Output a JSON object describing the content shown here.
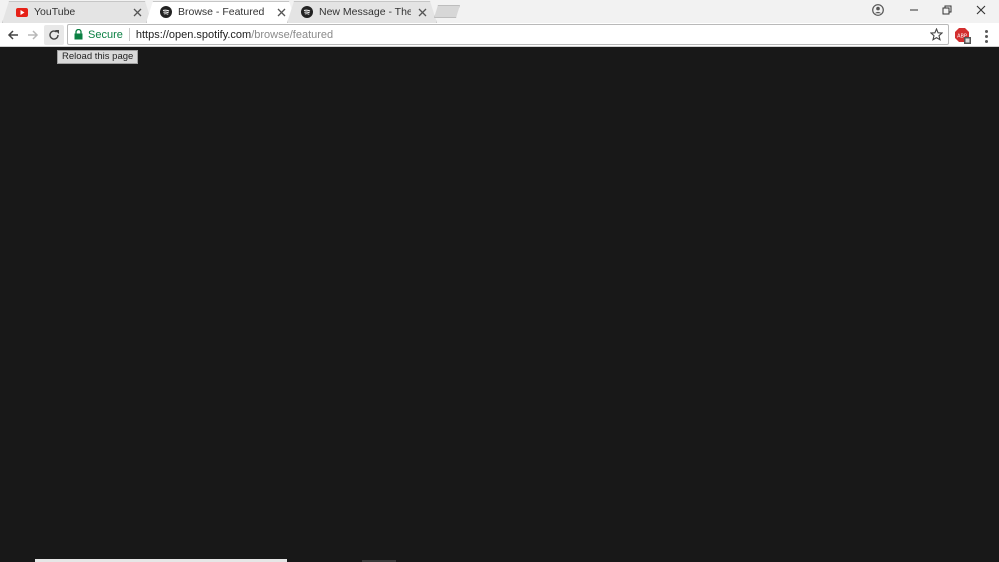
{
  "tabs": [
    {
      "title": "YouTube",
      "favicon": "youtube-icon",
      "active": false
    },
    {
      "title": "Browse - Featured",
      "favicon": "spotify-icon",
      "active": true
    },
    {
      "title": "New Message - The Spot",
      "favicon": "spotify-icon",
      "active": false
    }
  ],
  "omnibox": {
    "secure_label": "Secure",
    "url_host": "https://open.spotify.com",
    "url_path": "/browse/featured"
  },
  "tooltip": {
    "text": "Reload this page"
  },
  "colors": {
    "secure_green": "#0b8043",
    "youtube_red": "#e62117",
    "page_background": "#181818"
  }
}
